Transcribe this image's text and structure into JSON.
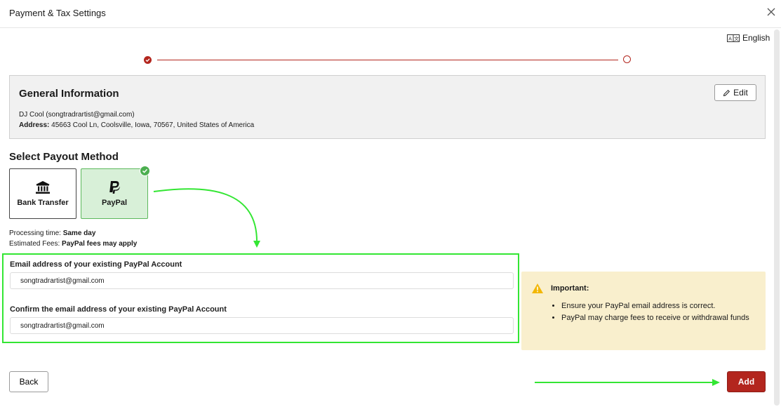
{
  "header": {
    "title": "Payment & Tax Settings",
    "close_icon": "close-icon"
  },
  "language": {
    "label": "English",
    "icon": "translate-icon"
  },
  "stepper": {
    "steps_total": 2,
    "steps_completed": 1
  },
  "general_info": {
    "title": "General Information",
    "name_email": "DJ Cool (songtradrartist@gmail.com)",
    "address_label": "Address:",
    "address_value": "45663 Cool Ln, Coolsville, Iowa, 70567, United States of America",
    "edit_label": "Edit"
  },
  "payout": {
    "title": "Select Payout Method",
    "methods": [
      {
        "label": "Bank Transfer",
        "icon": "bank-icon",
        "selected": false
      },
      {
        "label": "PayPal",
        "icon": "paypal-icon",
        "selected": true
      }
    ],
    "processing_label": "Processing time:",
    "processing_value": "Same day",
    "fees_label": "Estimated Fees:",
    "fees_value": "PayPal fees may apply"
  },
  "form": {
    "email_label": "Email address of your existing PayPal Account",
    "email_value": "songtradrartist@gmail.com",
    "confirm_label": "Confirm the email address of your existing PayPal Account",
    "confirm_value": "songtradrartist@gmail.com"
  },
  "important": {
    "title": "Important:",
    "bullets": [
      "Ensure your PayPal email address is correct.",
      "PayPal may charge fees to receive or withdrawal funds"
    ]
  },
  "footer": {
    "back_label": "Back",
    "add_label": "Add"
  },
  "colors": {
    "accent": "#b3261e",
    "selected_bg": "#d8f0d8",
    "success": "#4caf50",
    "warning_bg": "#f9efcd",
    "annotation": "#33e633"
  }
}
